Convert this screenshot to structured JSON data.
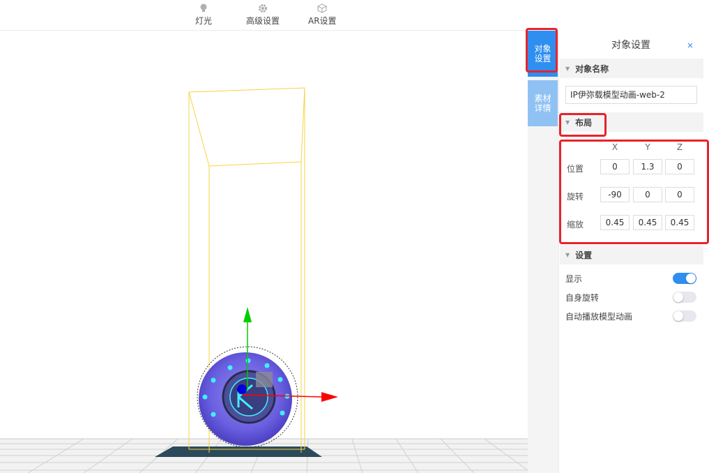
{
  "toolbar": {
    "items": [
      {
        "label": "灯光",
        "icon": "bulb-icon"
      },
      {
        "label": "高级设置",
        "icon": "gear-icon"
      },
      {
        "label": "AR设置",
        "icon": "cube-icon"
      }
    ]
  },
  "side_tabs": [
    {
      "label": "对象\n设置",
      "active": true
    },
    {
      "label": "素材\n详情",
      "active": false
    }
  ],
  "panel": {
    "title": "对象设置",
    "close": "×",
    "sections": {
      "name": "对象名称",
      "layout": "布局",
      "settings": "设置"
    },
    "object_name": "IP伊弥载模型动画-web-2",
    "axes": [
      "X",
      "Y",
      "Z"
    ],
    "rows": [
      {
        "label": "位置",
        "values": [
          "0",
          "1.3",
          "0"
        ]
      },
      {
        "label": "旋转",
        "values": [
          "-90",
          "0",
          "0"
        ]
      },
      {
        "label": "缩放",
        "values": [
          "0.45",
          "0.45",
          "0.45"
        ]
      }
    ],
    "toggles": [
      {
        "label": "显示",
        "on": true
      },
      {
        "label": "自身旋转",
        "on": false
      },
      {
        "label": "自动播放模型动画",
        "on": false
      }
    ]
  },
  "colors": {
    "accent": "#2f8ff0",
    "highlight": "#e8232a",
    "gizmo_x": "#ff0000",
    "gizmo_y": "#00cc00",
    "bounding_box": "#f5d442"
  }
}
